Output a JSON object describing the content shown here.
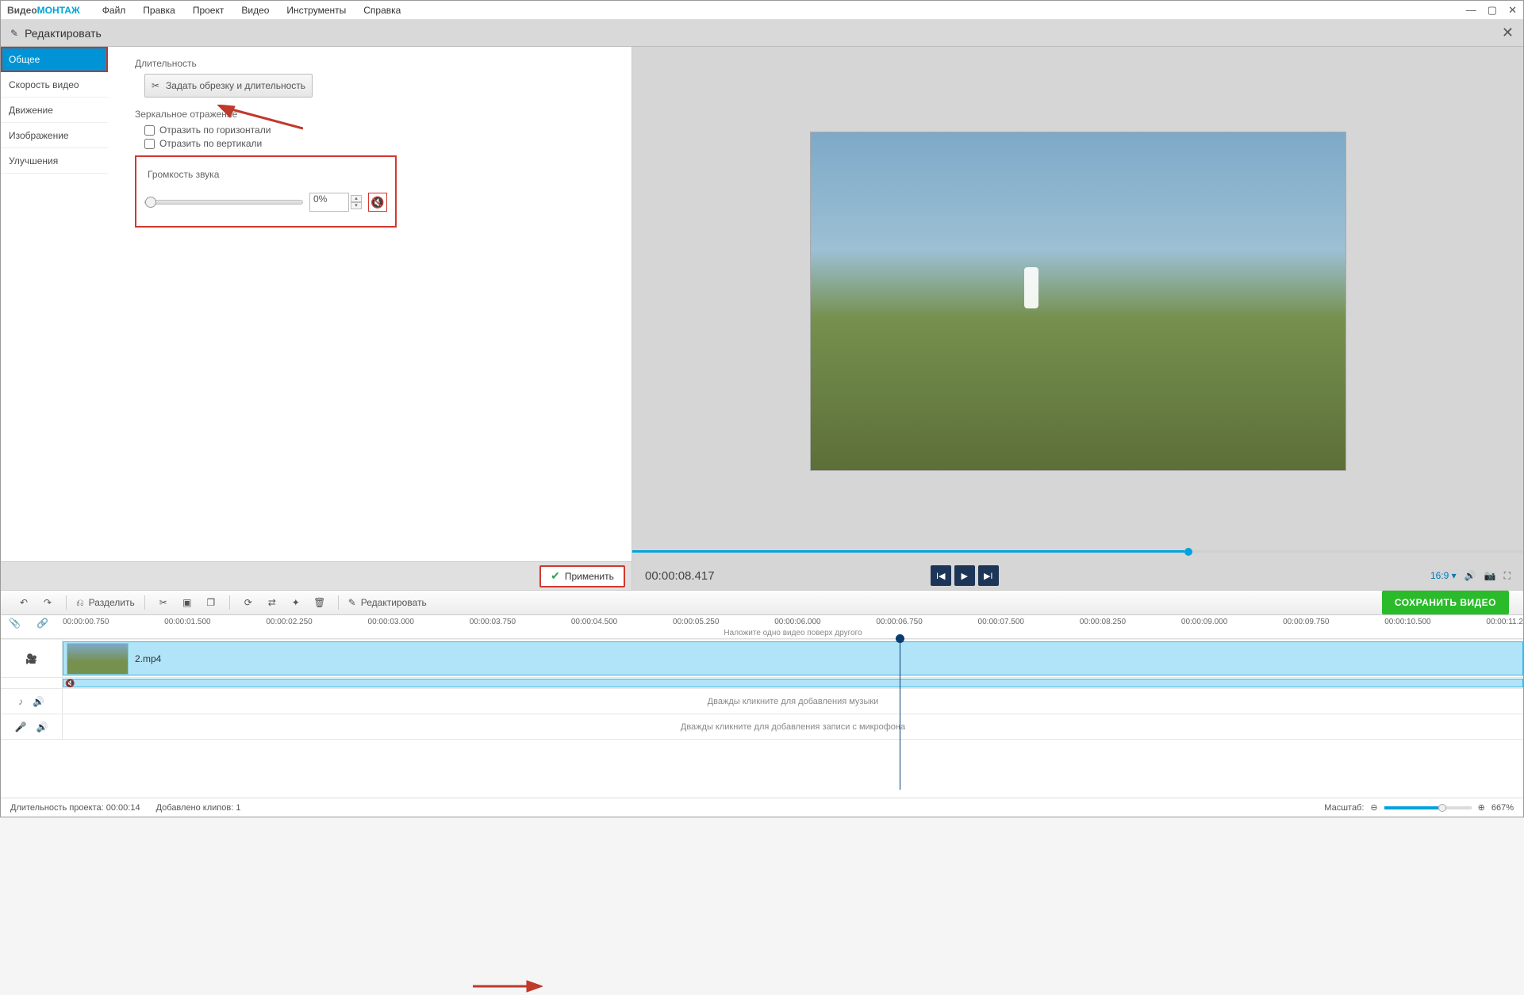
{
  "brand": {
    "a": "Видео",
    "b": "МОНТАЖ"
  },
  "menu": {
    "file": "Файл",
    "edit": "Правка",
    "project": "Проект",
    "video": "Видео",
    "tools": "Инструменты",
    "help": "Справка"
  },
  "editor": {
    "title": "Редактировать"
  },
  "tabs": {
    "general": "Общее",
    "speed": "Скорость видео",
    "motion": "Движение",
    "image": "Изображение",
    "enhance": "Улучшения"
  },
  "form": {
    "duration_label": "Длительность",
    "crop_button": "Задать обрезку и длительность",
    "mirror_label": "Зеркальное отражение",
    "flip_h": "Отразить по горизонтали",
    "flip_v": "Отразить по вертикали",
    "volume_label": "Громкость звука",
    "volume_value": "0%"
  },
  "apply": {
    "label": "Применить"
  },
  "preview": {
    "timecode": "00:00:08.417",
    "ratio": "16:9"
  },
  "toolbar": {
    "split": "Разделить",
    "edit": "Редактировать",
    "save": "СОХРАНИТЬ ВИДЕО"
  },
  "ruler": {
    "ticks": [
      "00:00:00.750",
      "00:00:01.500",
      "00:00:02.250",
      "00:00:03.000",
      "00:00:03.750",
      "00:00:04.500",
      "00:00:05.250",
      "00:00:06.000",
      "00:00:06.750",
      "00:00:07.500",
      "00:00:08.250",
      "00:00:09.000",
      "00:00:09.750",
      "00:00:10.500",
      "00:00:11.2"
    ],
    "overlay_hint": "Наложите одно видео поверх другого"
  },
  "tracks": {
    "clip_name": "2.mp4",
    "music_hint": "Дважды кликните для добавления музыки",
    "mic_hint": "Дважды кликните для добавления записи с микрофона"
  },
  "status": {
    "dur_label": "Длительность проекта:",
    "dur_value": "00:00:14",
    "clips_label": "Добавлено клипов:",
    "clips_value": "1",
    "zoom_label": "Масштаб:",
    "zoom_value": "667%"
  }
}
